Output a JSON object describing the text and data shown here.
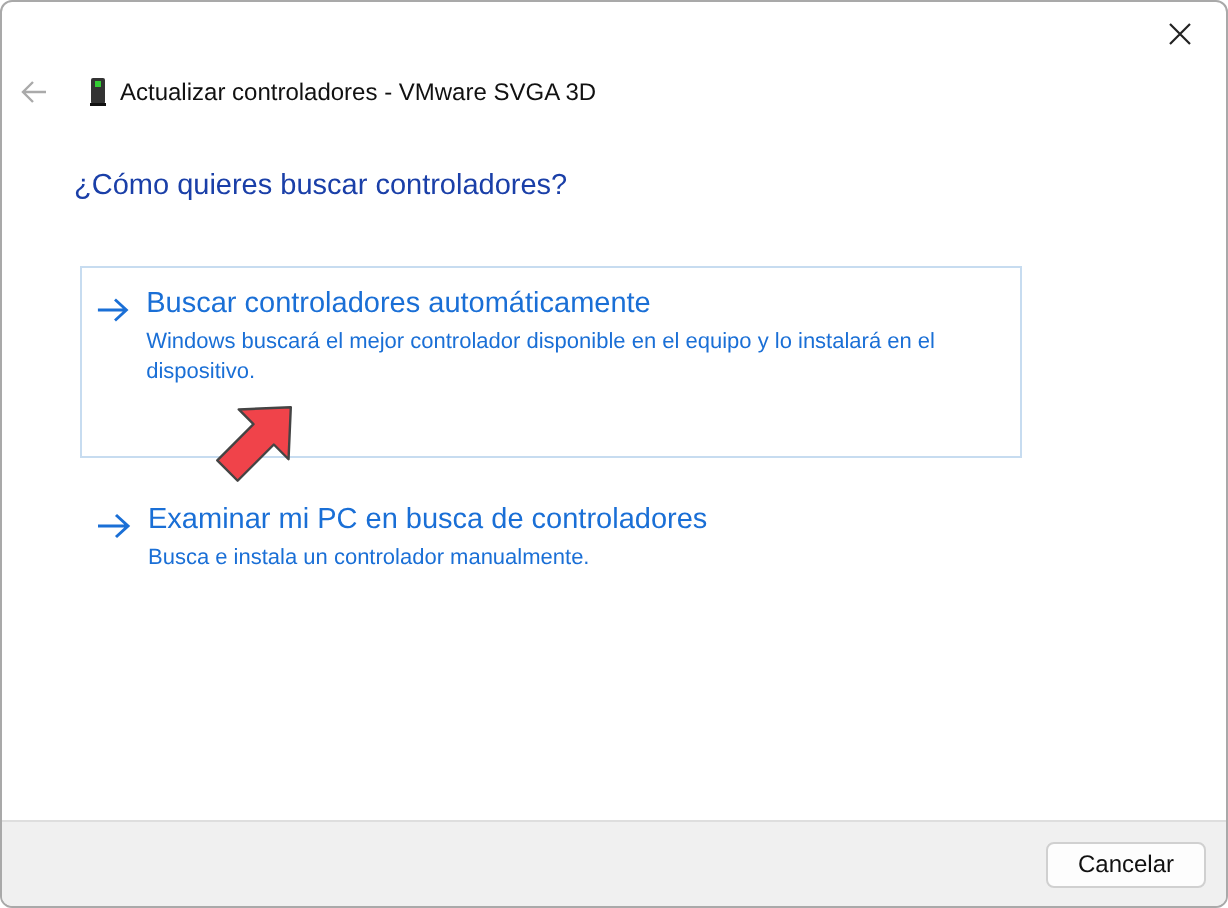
{
  "window": {
    "title": "Actualizar controladores - VMware SVGA 3D"
  },
  "heading": "¿Cómo quieres buscar controladores?",
  "options": [
    {
      "title": "Buscar controladores automáticamente",
      "description": "Windows buscará el mejor controlador disponible en el equipo y lo instalará en el dispositivo.",
      "selected": true
    },
    {
      "title": "Examinar mi PC en busca de controladores",
      "description": "Busca e instala un controlador manualmente.",
      "selected": false
    }
  ],
  "buttons": [
    "Cancelar"
  ]
}
